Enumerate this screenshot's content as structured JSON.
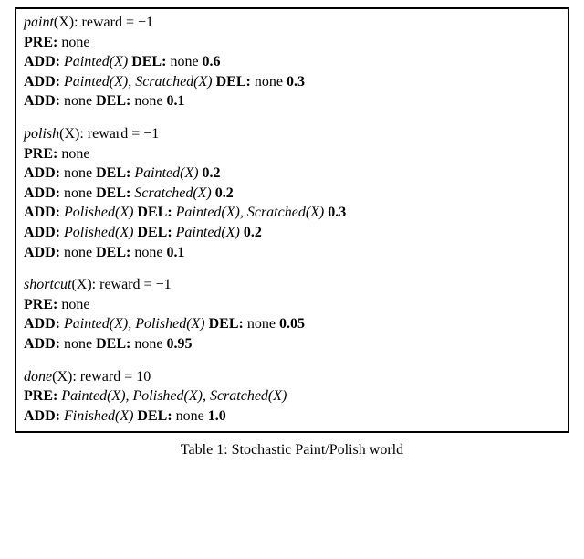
{
  "labels": {
    "PRE": "PRE:",
    "ADD": "ADD:",
    "DEL": "DEL:",
    "none": "none",
    "reward_sep": ": reward = "
  },
  "actions": {
    "paint": {
      "name": "paint",
      "arg": "(X)",
      "reward": "−1",
      "pre": "none",
      "effects": [
        {
          "add": "Painted(X)",
          "del": "none",
          "prob": "0.6"
        },
        {
          "add": "Painted(X), Scratched(X)",
          "del": "none",
          "prob": "0.3"
        },
        {
          "add": "none",
          "del": "none",
          "prob": "0.1"
        }
      ]
    },
    "polish": {
      "name": "polish",
      "arg": "(X)",
      "reward": "−1",
      "pre": "none",
      "effects": [
        {
          "add": "none",
          "del": "Painted(X)",
          "prob": "0.2"
        },
        {
          "add": "none",
          "del": "Scratched(X)",
          "prob": "0.2"
        },
        {
          "add": "Polished(X)",
          "del": "Painted(X), Scratched(X)",
          "prob": "0.3"
        },
        {
          "add": "Polished(X)",
          "del": "Painted(X)",
          "prob": "0.2"
        },
        {
          "add": "none",
          "del": "none",
          "prob": "0.1"
        }
      ]
    },
    "shortcut": {
      "name": "shortcut",
      "arg": "(X)",
      "reward": "−1",
      "pre": "none",
      "effects": [
        {
          "add": "Painted(X), Polished(X)",
          "del": "none",
          "prob": "0.05"
        },
        {
          "add": "none",
          "del": "none",
          "prob": "0.95"
        }
      ]
    },
    "done": {
      "name": "done",
      "arg": "(X)",
      "reward": "10",
      "pre": "Painted(X), Polished(X),  Scratched(X)",
      "effects": [
        {
          "add": "Finished(X)",
          "del": "none",
          "prob": "1.0"
        }
      ]
    }
  },
  "caption": "Table 1: Stochastic Paint/Polish world"
}
